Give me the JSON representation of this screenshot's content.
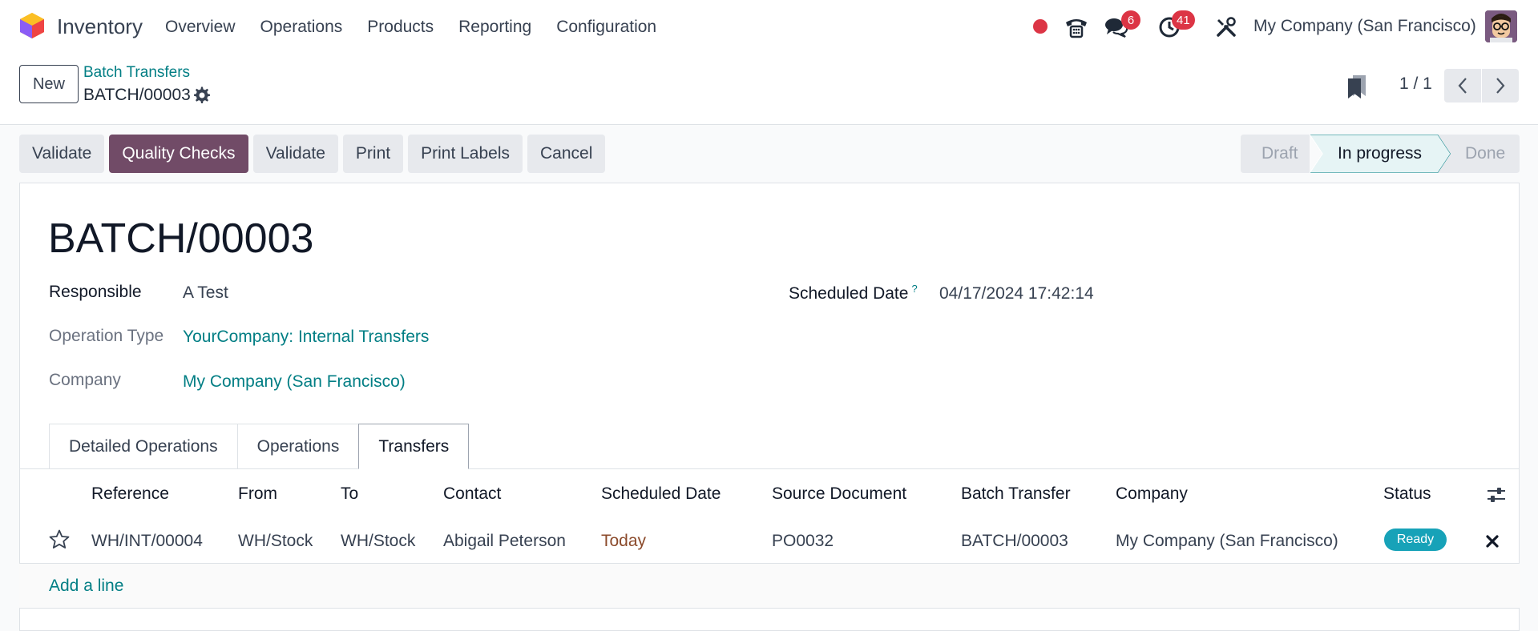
{
  "nav": {
    "app_name": "Inventory",
    "menu": [
      "Overview",
      "Operations",
      "Products",
      "Reporting",
      "Configuration"
    ],
    "messages_count": "6",
    "activities_count": "41",
    "company": "My Company (San Francisco)"
  },
  "control_panel": {
    "new_label": "New",
    "breadcrumb_parent": "Batch Transfers",
    "breadcrumb_current": "BATCH/00003",
    "pager": "1 / 1"
  },
  "actions": [
    "Validate",
    "Quality Checks",
    "Validate",
    "Print",
    "Print Labels",
    "Cancel"
  ],
  "stages": {
    "draft": "Draft",
    "in_progress": "In progress",
    "done": "Done",
    "current": "In progress"
  },
  "record": {
    "title": "BATCH/00003",
    "responsible_label": "Responsible",
    "responsible": "A Test",
    "operation_type_label": "Operation Type",
    "operation_type": "YourCompany: Internal Transfers",
    "company_label": "Company",
    "company": "My Company (San Francisco)",
    "scheduled_date_label": "Scheduled Date",
    "scheduled_date_help": "?",
    "scheduled_date": "04/17/2024 17:42:14"
  },
  "tabs": [
    "Detailed Operations",
    "Operations",
    "Transfers"
  ],
  "active_tab": "Transfers",
  "table": {
    "headers": [
      "Reference",
      "From",
      "To",
      "Contact",
      "Scheduled Date",
      "Source Document",
      "Batch Transfer",
      "Company",
      "Status"
    ],
    "rows": [
      {
        "reference": "WH/INT/00004",
        "from": "WH/Stock",
        "to": "WH/Stock",
        "contact": "Abigail Peterson",
        "scheduled_date": "Today",
        "source_document": "PO0032",
        "batch_transfer": "BATCH/00003",
        "company": "My Company (San Francisco)",
        "status": "Ready"
      }
    ],
    "add_line": "Add a line"
  },
  "colors": {
    "primary": "#714b67",
    "link": "#017e84",
    "badge": "#dc3545",
    "ready": "#17a2b8",
    "today": "#8b4a2b"
  }
}
